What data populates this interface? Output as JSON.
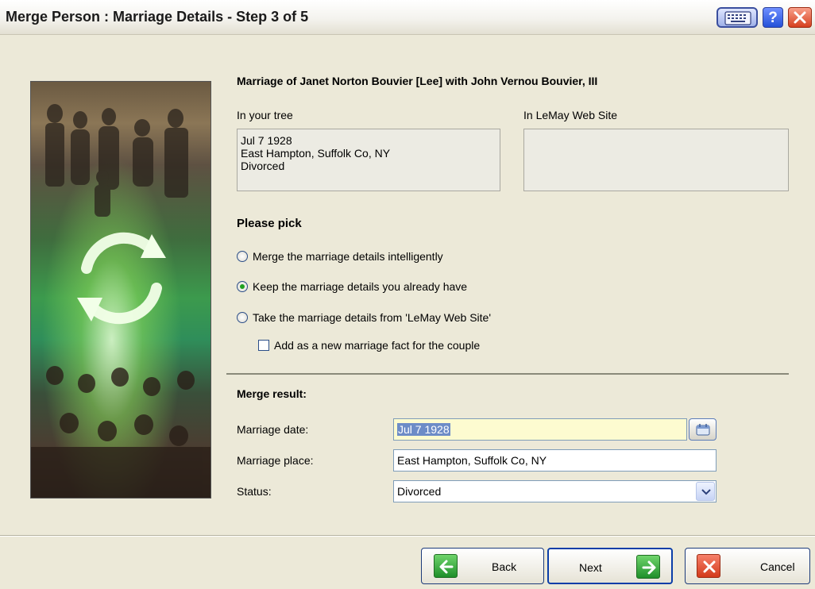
{
  "window": {
    "title": "Merge Person : Marriage Details - Step 3 of 5",
    "icons": [
      "keyboard-icon",
      "help-icon",
      "close-icon"
    ],
    "help_label": "?"
  },
  "marriage_heading": "Marriage of Janet Norton Bouvier [Lee] with John Vernou Bouvier, III",
  "comparison": {
    "tree_label": "In your tree",
    "tree_lines": [
      "Jul 7 1928",
      "East Hampton, Suffolk Co, NY",
      "Divorced"
    ],
    "web_label": "In LeMay Web Site",
    "web_lines": []
  },
  "pick": {
    "heading": "Please pick",
    "options": [
      {
        "label": "Merge the marriage details intelligently",
        "checked": false
      },
      {
        "label": "Keep the marriage details you already have",
        "checked": true
      },
      {
        "label": "Take the marriage details from 'LeMay Web Site'",
        "checked": false
      }
    ],
    "add_new_fact": {
      "label": "Add as a new marriage fact for the couple",
      "checked": false
    }
  },
  "result": {
    "heading": "Merge result:",
    "date_label": "Marriage date:",
    "date_value": "Jul 7 1928",
    "place_label": "Marriage place:",
    "place_value": "East Hampton, Suffolk Co, NY",
    "status_label": "Status:",
    "status_value": "Divorced"
  },
  "buttons": {
    "back": "Back",
    "next": "Next",
    "cancel": "Cancel"
  },
  "colors": {
    "dialog_bg": "#ece9d8",
    "date_field_bg": "#fdfbd0",
    "selection": "#6d8cc7",
    "accent_blue": "#0b3ea8"
  }
}
